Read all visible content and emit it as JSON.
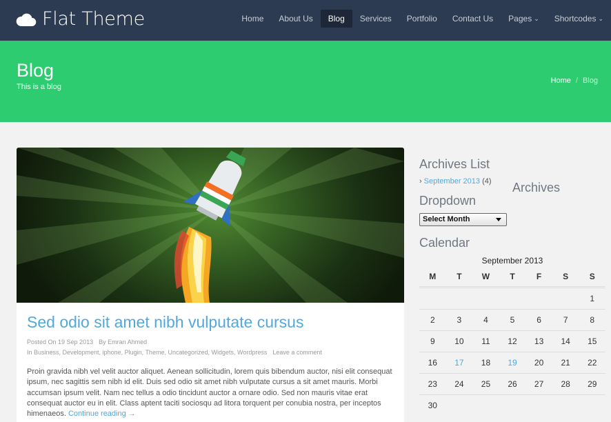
{
  "header": {
    "site_title": "Flat Theme",
    "logo_icon": "cloud-icon",
    "nav": [
      {
        "label": "Home",
        "active": false
      },
      {
        "label": "About Us",
        "active": false
      },
      {
        "label": "Blog",
        "active": true
      },
      {
        "label": "Services",
        "active": false
      },
      {
        "label": "Portfolio",
        "active": false
      },
      {
        "label": "Contact Us",
        "active": false
      },
      {
        "label": "Pages",
        "active": false,
        "dropdown": true
      },
      {
        "label": "Shortcodes",
        "active": false,
        "dropdown": true
      }
    ],
    "caret": "⌄"
  },
  "banner": {
    "title": "Blog",
    "subtitle": "This is a blog",
    "breadcrumb": {
      "home": "Home",
      "separator": "/",
      "current": "Blog"
    }
  },
  "post": {
    "title": "Sed odio sit amet nibh vulputate cursus",
    "posted_on": "Posted On 19 Sep 2013",
    "author": "By Emran Ahmed",
    "categories": "In Business, Development, iphone, Plugin, Theme, Uncategorized, Widgets, Wordpress",
    "comment_link": "Leave a comment",
    "body": "Proin gravida nibh vel velit auctor aliquet. Aenean sollicitudin, lorem quis bibendum auctor, nisi elit consequat ipsum, nec sagittis sem nibh id elit. Duis sed odio sit amet nibh vulputate cursus a sit amet mauris. Morbi accumsan ipsum velit. Nam nec tellus a odio tincidunt auctor a ornare odio. Sed non mauris vitae erat consequat auctor eu in elit. Class aptent taciti sociosqu ad litora torquent per conubia nostra, per inceptos himenaeos.",
    "continue": "Continue reading →",
    "image_icon": "rocket-icon"
  },
  "sidebar": {
    "archives_list_title": "Archives List",
    "archives_item": "September 2013",
    "archives_count": "(4)",
    "archives_title": "Archives",
    "dropdown_title": "Dropdown",
    "select_value": "Select Month",
    "calendar_title": "Calendar"
  },
  "calendar": {
    "caption": "September 2013",
    "days": [
      "M",
      "T",
      "W",
      "T",
      "F",
      "S",
      "S"
    ],
    "weeks": [
      [
        "",
        "",
        "",
        "",
        "",
        "",
        "1"
      ],
      [
        "2",
        "3",
        "4",
        "5",
        "6",
        "7",
        "8"
      ],
      [
        "9",
        "10",
        "11",
        "12",
        "13",
        "14",
        "15"
      ],
      [
        "16",
        "17",
        "18",
        "19",
        "20",
        "21",
        "22"
      ],
      [
        "23",
        "24",
        "25",
        "26",
        "27",
        "28",
        "29"
      ],
      [
        "30",
        "",
        "",
        "",
        "",
        "",
        ""
      ]
    ],
    "linked_days": [
      "17",
      "19"
    ]
  },
  "colors": {
    "header_bg": "#2d3b52",
    "banner_bg": "#2ecc71",
    "link": "#52a8dc",
    "active_nav_bg": "#1d2738"
  }
}
